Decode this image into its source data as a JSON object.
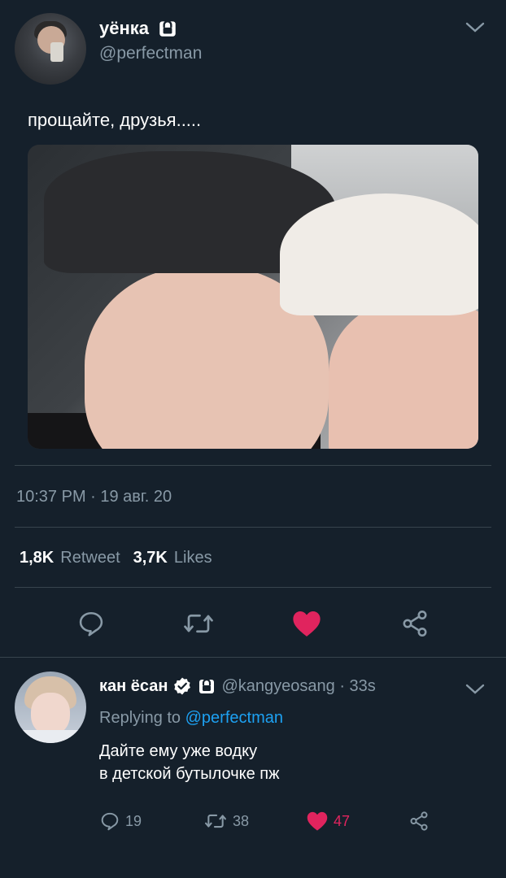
{
  "tweet": {
    "display_name": "уёнка",
    "handle": "@perfectman",
    "text": "прощайте, друзья.....",
    "timestamp": "10:37 PM · 19 авг. 20",
    "retweets_count": "1,8K",
    "retweets_label": "Retweet",
    "likes_count": "3,7K",
    "likes_label": "Likes",
    "liked": true,
    "icons": [
      "lock-icon",
      "chevron-down-icon",
      "reply-icon",
      "retweet-icon",
      "like-icon",
      "share-icon"
    ]
  },
  "reply": {
    "display_name": "кан ёсан",
    "handle_time": "@kangyeosang · 33s",
    "replying_prefix": "Replying to",
    "replying_to": "@perfectman",
    "text_line1": "Дайте ему уже водку",
    "text_line2": "в детской бутылочке пж",
    "reply_count": "19",
    "retweet_count": "38",
    "like_count": "47"
  },
  "colors": {
    "background": "#15202b",
    "secondary_text": "#8899a6",
    "link": "#1da1f2",
    "like": "#e0245e",
    "verified": "#ffffff",
    "divider": "#38444d"
  }
}
